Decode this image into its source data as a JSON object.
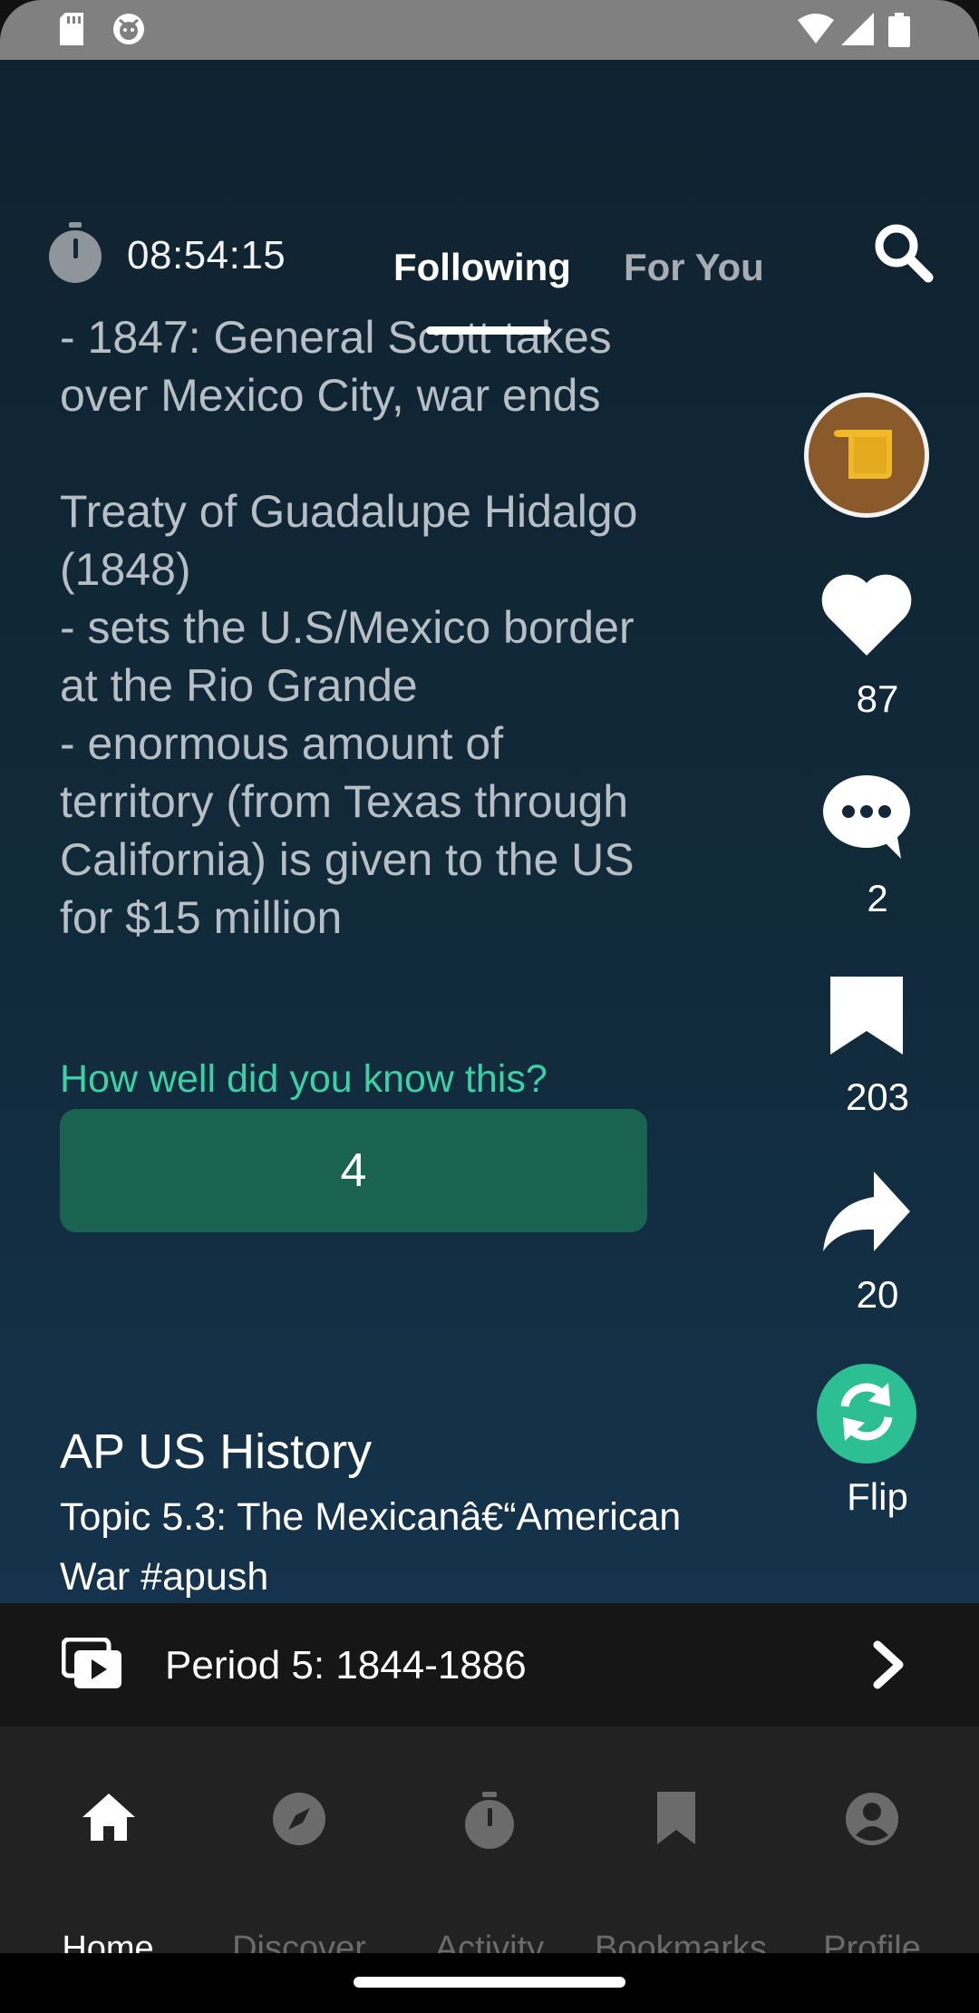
{
  "status_bar": {
    "icons_left": [
      "sd-card-icon",
      "android-debug-icon"
    ],
    "icons_right": [
      "wifi-icon",
      "signal-icon",
      "battery-icon"
    ]
  },
  "header": {
    "timer": "08:54:15",
    "tabs": [
      {
        "label": "Following",
        "active": true
      },
      {
        "label": "For You",
        "active": false
      }
    ]
  },
  "card": {
    "body": "- 1847: General Scott takes\nover Mexico City, war ends\n\nTreaty of Guadalupe Hidalgo\n(1848)\n- sets the U.S/Mexico border\nat the Rio Grande\n- enormous amount of\nterritory (from Texas through\nCalifornia) is given to the US\nfor $15 million",
    "question": "How well did you know this?",
    "answer": "4",
    "deck_title": "AP US History",
    "topic": "Topic 5.3: The Mexicanâ€“American War #apush"
  },
  "rail": {
    "likes": "87",
    "comments": "2",
    "bookmarks": "203",
    "shares": "20",
    "flip_label": "Flip"
  },
  "period_bar": {
    "label": "Period 5: 1844-1886"
  },
  "nav": {
    "items": [
      {
        "label": "Home",
        "icon": "home-icon",
        "active": true
      },
      {
        "label": "Discover",
        "icon": "compass-icon",
        "active": false
      },
      {
        "label": "Activity",
        "icon": "stopwatch-icon",
        "active": false
      },
      {
        "label": "Bookmarks",
        "icon": "bookmark-icon",
        "active": false
      },
      {
        "label": "Profile",
        "icon": "account-icon",
        "active": false
      }
    ]
  },
  "colors": {
    "accent": "#2bbf93",
    "answer_button": "#1a6350",
    "question_text": "#3dcfa6"
  }
}
